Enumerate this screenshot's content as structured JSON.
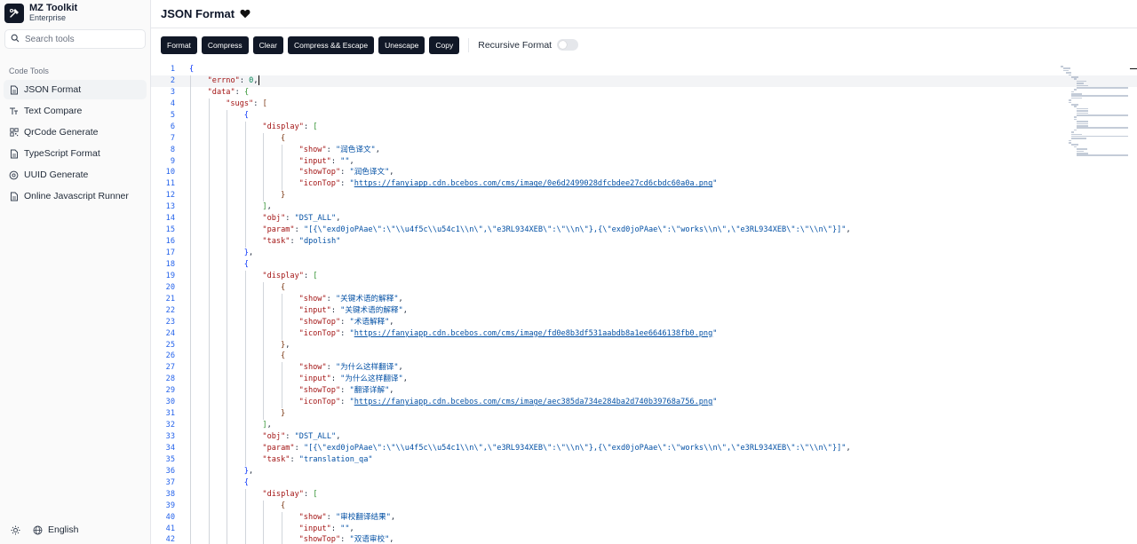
{
  "app": {
    "name": "MZ Toolkit",
    "edition": "Enterprise"
  },
  "search": {
    "placeholder": "Search tools"
  },
  "sidebar": {
    "section": "Code Tools",
    "items": [
      {
        "label": "JSON Format",
        "icon": "file-icon",
        "active": true
      },
      {
        "label": "Text Compare",
        "icon": "text-icon",
        "active": false
      },
      {
        "label": "QrCode Generate",
        "icon": "qrcode-icon",
        "active": false
      },
      {
        "label": "TypeScript Format",
        "icon": "file-icon",
        "active": false
      },
      {
        "label": "UUID Generate",
        "icon": "cube-icon",
        "active": false
      },
      {
        "label": "Online Javascript Runner",
        "icon": "file-icon",
        "active": false
      }
    ],
    "footer": {
      "theme_icon": "sun-icon",
      "language": "English",
      "language_icon": "globe-icon"
    }
  },
  "header": {
    "title": "JSON Format",
    "title_icon": "heart-icon"
  },
  "toolbar": {
    "buttons": [
      "Format",
      "Compress",
      "Clear",
      "Compress && Escape",
      "Unescape",
      "Copy"
    ],
    "recursive_label": "Recursive Format",
    "recursive_on": false
  },
  "editor": {
    "current_line": 2,
    "lines": [
      [
        0,
        [
          [
            "b1",
            "{"
          ]
        ]
      ],
      [
        1,
        [
          [
            "k",
            "\"errno\""
          ],
          [
            "p",
            ": "
          ],
          [
            "n",
            "0"
          ],
          [
            "p",
            ","
          ]
        ]
      ],
      [
        1,
        [
          [
            "k",
            "\"data\""
          ],
          [
            "p",
            ": "
          ],
          [
            "b2",
            "{"
          ]
        ]
      ],
      [
        2,
        [
          [
            "k",
            "\"sugs\""
          ],
          [
            "p",
            ": "
          ],
          [
            "b3",
            "["
          ]
        ]
      ],
      [
        3,
        [
          [
            "b1",
            "{"
          ]
        ]
      ],
      [
        4,
        [
          [
            "k",
            "\"display\""
          ],
          [
            "p",
            ": "
          ],
          [
            "b2",
            "["
          ]
        ]
      ],
      [
        5,
        [
          [
            "b3",
            "{"
          ]
        ]
      ],
      [
        6,
        [
          [
            "k",
            "\"show\""
          ],
          [
            "p",
            ": "
          ],
          [
            "s",
            "\"润色译文\""
          ],
          [
            "p",
            ","
          ]
        ]
      ],
      [
        6,
        [
          [
            "k",
            "\"input\""
          ],
          [
            "p",
            ": "
          ],
          [
            "s",
            "\"\""
          ],
          [
            "p",
            ","
          ]
        ]
      ],
      [
        6,
        [
          [
            "k",
            "\"showTop\""
          ],
          [
            "p",
            ": "
          ],
          [
            "s",
            "\"润色译文\""
          ],
          [
            "p",
            ","
          ]
        ]
      ],
      [
        6,
        [
          [
            "k",
            "\"iconTop\""
          ],
          [
            "p",
            ": "
          ],
          [
            "s",
            "\""
          ],
          [
            "u",
            "https://fanyiapp.cdn.bcebos.com/cms/image/0e6d2499028dfcbdee27cd6cbdc60a0a.png"
          ],
          [
            "s",
            "\""
          ]
        ]
      ],
      [
        5,
        [
          [
            "b3",
            "}"
          ]
        ]
      ],
      [
        4,
        [
          [
            "b2",
            "]"
          ],
          [
            "p",
            ","
          ]
        ]
      ],
      [
        4,
        [
          [
            "k",
            "\"obj\""
          ],
          [
            "p",
            ": "
          ],
          [
            "s",
            "\"DST_ALL\""
          ],
          [
            "p",
            ","
          ]
        ]
      ],
      [
        4,
        [
          [
            "k",
            "\"param\""
          ],
          [
            "p",
            ": "
          ],
          [
            "s",
            "\"[{\\\"exd0joPAae\\\":\\\"\\\\u4f5c\\\\u54c1\\\\n\\\",\\\"e3RL934XEB\\\":\\\"\\\\n\\\"},{\\\"exd0joPAae\\\":\\\"works\\\\n\\\",\\\"e3RL934XEB\\\":\\\"\\\\n\\\"}]\""
          ],
          [
            "p",
            ","
          ]
        ]
      ],
      [
        4,
        [
          [
            "k",
            "\"task\""
          ],
          [
            "p",
            ": "
          ],
          [
            "s",
            "\"dpolish\""
          ]
        ]
      ],
      [
        3,
        [
          [
            "b1",
            "}"
          ],
          [
            "p",
            ","
          ]
        ]
      ],
      [
        3,
        [
          [
            "b1",
            "{"
          ]
        ]
      ],
      [
        4,
        [
          [
            "k",
            "\"display\""
          ],
          [
            "p",
            ": "
          ],
          [
            "b2",
            "["
          ]
        ]
      ],
      [
        5,
        [
          [
            "b3",
            "{"
          ]
        ]
      ],
      [
        6,
        [
          [
            "k",
            "\"show\""
          ],
          [
            "p",
            ": "
          ],
          [
            "s",
            "\"关键术语的解释\""
          ],
          [
            "p",
            ","
          ]
        ]
      ],
      [
        6,
        [
          [
            "k",
            "\"input\""
          ],
          [
            "p",
            ": "
          ],
          [
            "s",
            "\"关键术语的解释\""
          ],
          [
            "p",
            ","
          ]
        ]
      ],
      [
        6,
        [
          [
            "k",
            "\"showTop\""
          ],
          [
            "p",
            ": "
          ],
          [
            "s",
            "\"术语解释\""
          ],
          [
            "p",
            ","
          ]
        ]
      ],
      [
        6,
        [
          [
            "k",
            "\"iconTop\""
          ],
          [
            "p",
            ": "
          ],
          [
            "s",
            "\""
          ],
          [
            "u",
            "https://fanyiapp.cdn.bcebos.com/cms/image/fd0e8b3df531aabdb8a1ee6646138fb0.png"
          ],
          [
            "s",
            "\""
          ]
        ]
      ],
      [
        5,
        [
          [
            "b3",
            "}"
          ],
          [
            "p",
            ","
          ]
        ]
      ],
      [
        5,
        [
          [
            "b3",
            "{"
          ]
        ]
      ],
      [
        6,
        [
          [
            "k",
            "\"show\""
          ],
          [
            "p",
            ": "
          ],
          [
            "s",
            "\"为什么这样翻译\""
          ],
          [
            "p",
            ","
          ]
        ]
      ],
      [
        6,
        [
          [
            "k",
            "\"input\""
          ],
          [
            "p",
            ": "
          ],
          [
            "s",
            "\"为什么这样翻译\""
          ],
          [
            "p",
            ","
          ]
        ]
      ],
      [
        6,
        [
          [
            "k",
            "\"showTop\""
          ],
          [
            "p",
            ": "
          ],
          [
            "s",
            "\"翻译详解\""
          ],
          [
            "p",
            ","
          ]
        ]
      ],
      [
        6,
        [
          [
            "k",
            "\"iconTop\""
          ],
          [
            "p",
            ": "
          ],
          [
            "s",
            "\""
          ],
          [
            "u",
            "https://fanyiapp.cdn.bcebos.com/cms/image/aec385da734e284ba2d740b39768a756.png"
          ],
          [
            "s",
            "\""
          ]
        ]
      ],
      [
        5,
        [
          [
            "b3",
            "}"
          ]
        ]
      ],
      [
        4,
        [
          [
            "b2",
            "]"
          ],
          [
            "p",
            ","
          ]
        ]
      ],
      [
        4,
        [
          [
            "k",
            "\"obj\""
          ],
          [
            "p",
            ": "
          ],
          [
            "s",
            "\"DST_ALL\""
          ],
          [
            "p",
            ","
          ]
        ]
      ],
      [
        4,
        [
          [
            "k",
            "\"param\""
          ],
          [
            "p",
            ": "
          ],
          [
            "s",
            "\"[{\\\"exd0joPAae\\\":\\\"\\\\u4f5c\\\\u54c1\\\\n\\\",\\\"e3RL934XEB\\\":\\\"\\\\n\\\"},{\\\"exd0joPAae\\\":\\\"works\\\\n\\\",\\\"e3RL934XEB\\\":\\\"\\\\n\\\"}]\""
          ],
          [
            "p",
            ","
          ]
        ]
      ],
      [
        4,
        [
          [
            "k",
            "\"task\""
          ],
          [
            "p",
            ": "
          ],
          [
            "s",
            "\"translation_qa\""
          ]
        ]
      ],
      [
        3,
        [
          [
            "b1",
            "}"
          ],
          [
            "p",
            ","
          ]
        ]
      ],
      [
        3,
        [
          [
            "b1",
            "{"
          ]
        ]
      ],
      [
        4,
        [
          [
            "k",
            "\"display\""
          ],
          [
            "p",
            ": "
          ],
          [
            "b2",
            "["
          ]
        ]
      ],
      [
        5,
        [
          [
            "b3",
            "{"
          ]
        ]
      ],
      [
        6,
        [
          [
            "k",
            "\"show\""
          ],
          [
            "p",
            ": "
          ],
          [
            "s",
            "\"审校翻译结果\""
          ],
          [
            "p",
            ","
          ]
        ]
      ],
      [
        6,
        [
          [
            "k",
            "\"input\""
          ],
          [
            "p",
            ": "
          ],
          [
            "s",
            "\"\""
          ],
          [
            "p",
            ","
          ]
        ]
      ],
      [
        6,
        [
          [
            "k",
            "\"showTop\""
          ],
          [
            "p",
            ": "
          ],
          [
            "s",
            "\"双语审校\""
          ],
          [
            "p",
            ","
          ]
        ]
      ],
      [
        6,
        [
          [
            "k",
            "\"iconTop\""
          ],
          [
            "p",
            ": "
          ],
          [
            "s",
            "\""
          ],
          [
            "u",
            "https://fanyiapp.cdn.bcebos.com/cms/image/da5a51c2ac80b2f0a8a7e96cf8295b87.png"
          ],
          [
            "s",
            "\""
          ]
        ]
      ]
    ]
  }
}
